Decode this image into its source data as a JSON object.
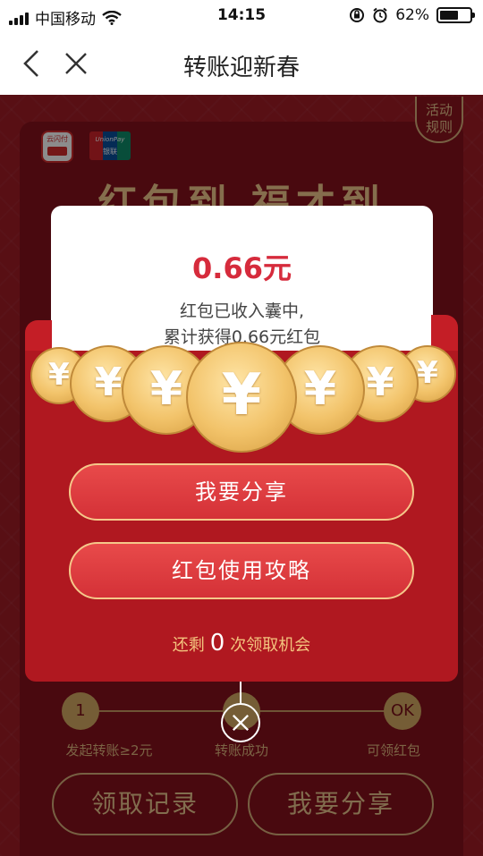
{
  "status_bar": {
    "carrier": "中国移动",
    "time": "14:15",
    "battery": "62%",
    "battery_level": 0.62
  },
  "nav": {
    "title": "转账迎新春"
  },
  "page": {
    "rules_label_1": "活动",
    "rules_label_2": "规则",
    "logo_quickpass": "云闪付",
    "logo_unionpay": "UnionPay",
    "logo_unionpay_cn": "银联",
    "headline": "红包到 福才到"
  },
  "steps": [
    {
      "marker": "1",
      "label": "发起转账≥2元"
    },
    {
      "marker": "",
      "label": "转账成功"
    },
    {
      "marker": "OK",
      "label": "可领红包"
    }
  ],
  "bottom_buttons": {
    "records": "领取记录",
    "share": "我要分享"
  },
  "popup": {
    "amount": "0.66元",
    "message_line1": "红包已收入囊中,",
    "message_line2": "累计获得0.66元红包",
    "coin_symbol": "¥",
    "share_button": "我要分享",
    "guide_button": "红包使用攻略",
    "remain_prefix": "还剩",
    "remain_count": "0",
    "remain_suffix": "次领取机会"
  },
  "colors": {
    "brand_red": "#d62b3c",
    "gold": "#f3c47e",
    "envelope": "#b01820"
  }
}
